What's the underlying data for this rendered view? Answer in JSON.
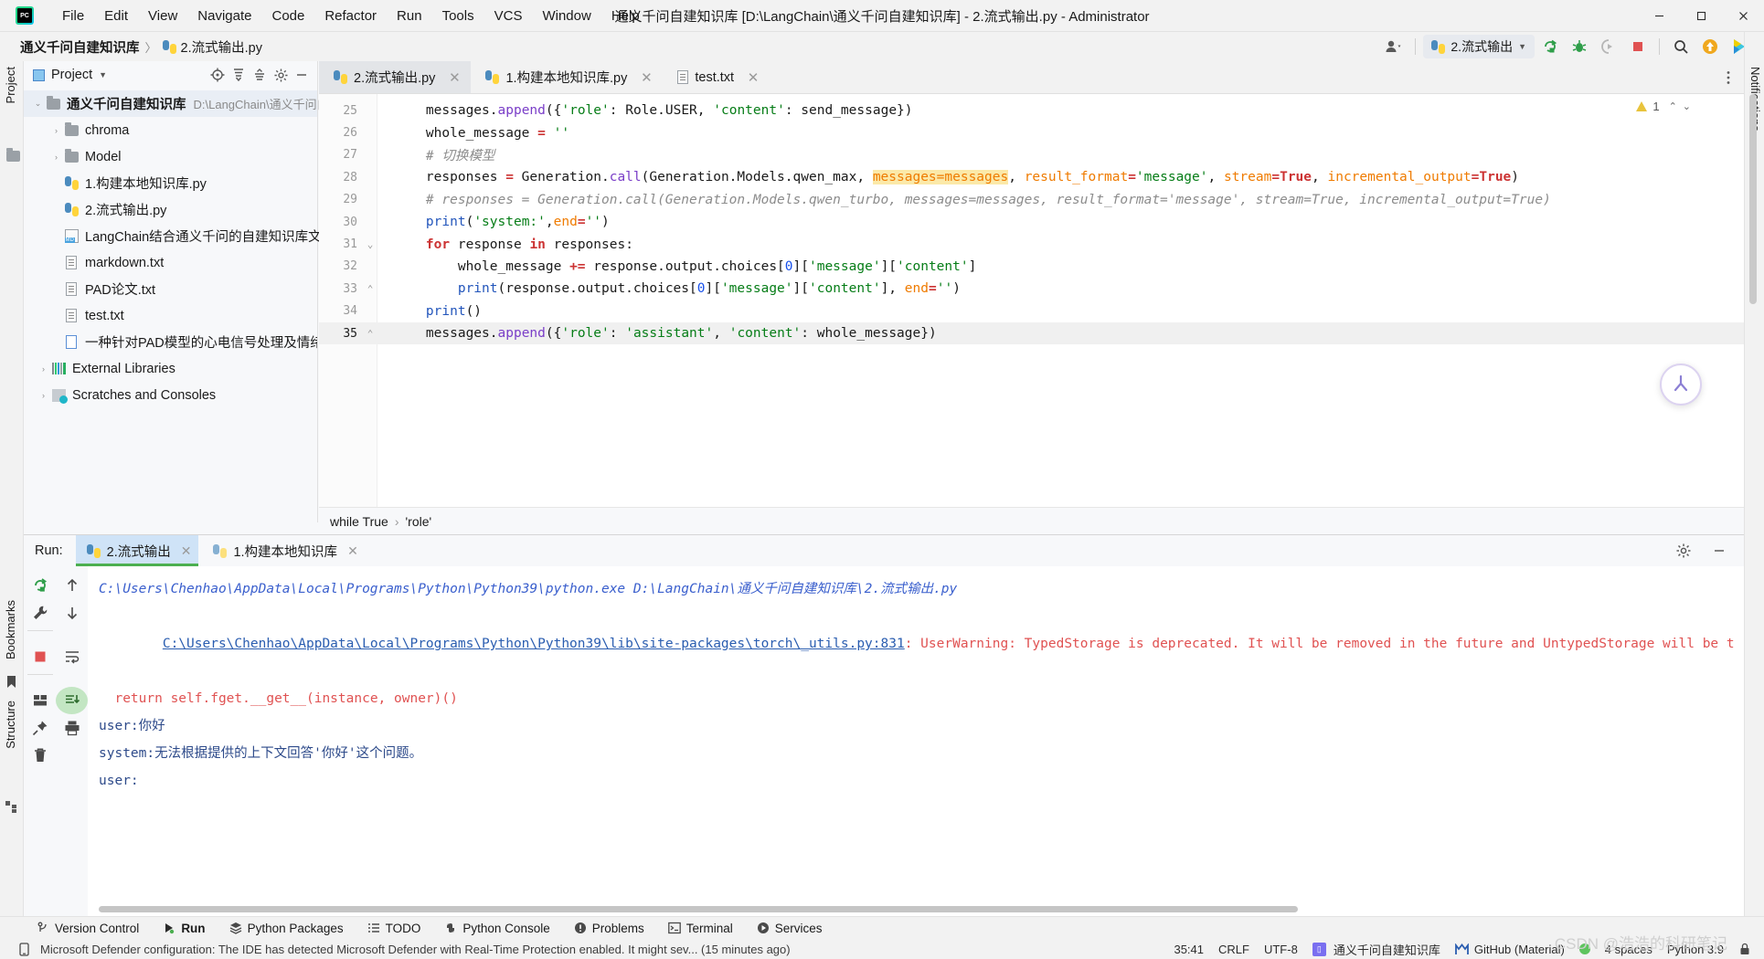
{
  "titlebar": {
    "app_logo": "pycharm-logo",
    "window_title": "通义千问自建知识库 [D:\\LangChain\\通义千问自建知识库] - 2.流式输出.py - Administrator",
    "menus": [
      "File",
      "Edit",
      "View",
      "Navigate",
      "Code",
      "Refactor",
      "Run",
      "Tools",
      "VCS",
      "Window",
      "Help"
    ],
    "controls": {
      "minimize": "—",
      "maximize": "▢",
      "close": "✕"
    }
  },
  "navbar": {
    "breadcrumb_project": "通义千问自建知识库",
    "breadcrumb_sep": "〉",
    "breadcrumb_file": "2.流式输出.py",
    "run_config": "2.流式输出",
    "icons": [
      "user-avatar-icon",
      "run-config-chevron",
      "rerun-icon",
      "debug-icon",
      "coverage-icon",
      "stop-icon",
      "search-everywhere-icon",
      "updates-icon",
      "ai-assistant-icon"
    ]
  },
  "left_stripe": {
    "project_label": "Project",
    "bookmarks_label": "Bookmarks",
    "structure_label": "Structure"
  },
  "right_stripe": {
    "notifications_label": "Notifications"
  },
  "project_panel": {
    "title": "Project",
    "header_icons": [
      "locate-icon",
      "expand-all-icon",
      "collapse-all-icon",
      "settings-icon",
      "hide-icon"
    ],
    "tree": [
      {
        "indent": 0,
        "arrow": "⌄",
        "icon": "folder-icon",
        "label": "通义千问自建知识库",
        "bold": true,
        "path": "D:\\LangChain\\通义千问自建知",
        "selected": true
      },
      {
        "indent": 1,
        "arrow": "›",
        "icon": "folder-icon",
        "label": "chroma",
        "bold": false,
        "path": "",
        "selected": false
      },
      {
        "indent": 1,
        "arrow": "›",
        "icon": "folder-icon",
        "label": "Model",
        "bold": false,
        "path": "",
        "selected": false
      },
      {
        "indent": 1,
        "arrow": "",
        "icon": "python-file-icon",
        "label": "1.构建本地知识库.py",
        "bold": false,
        "path": "",
        "selected": false
      },
      {
        "indent": 1,
        "arrow": "",
        "icon": "python-file-icon",
        "label": "2.流式输出.py",
        "bold": false,
        "path": "",
        "selected": false
      },
      {
        "indent": 1,
        "arrow": "",
        "icon": "markdown-file-icon",
        "label": "LangChain结合通义千问的自建知识库文档.md",
        "bold": false,
        "path": "",
        "selected": false
      },
      {
        "indent": 1,
        "arrow": "",
        "icon": "text-file-icon",
        "label": "markdown.txt",
        "bold": false,
        "path": "",
        "selected": false
      },
      {
        "indent": 1,
        "arrow": "",
        "icon": "text-file-icon",
        "label": "PAD论文.txt",
        "bold": false,
        "path": "",
        "selected": false
      },
      {
        "indent": 1,
        "arrow": "",
        "icon": "text-file-icon",
        "label": "test.txt",
        "bold": false,
        "path": "",
        "selected": false
      },
      {
        "indent": 1,
        "arrow": "",
        "icon": "pdf-file-icon",
        "label": "一种针对PAD模型的心电信号处理及情绪识别方",
        "bold": false,
        "path": "",
        "selected": false
      },
      {
        "indent": 0,
        "arrow": "›",
        "icon": "external-libraries-icon",
        "label": "External Libraries",
        "bold": false,
        "path": "",
        "selected": false
      },
      {
        "indent": 0,
        "arrow": "›",
        "icon": "scratches-icon",
        "label": "Scratches and Consoles",
        "bold": false,
        "path": "",
        "selected": false
      }
    ]
  },
  "editor": {
    "tabs": [
      {
        "label": "2.流式输出.py",
        "icon": "python-file-icon",
        "active": true
      },
      {
        "label": "1.构建本地知识库.py",
        "icon": "python-file-icon",
        "active": false
      },
      {
        "label": "test.txt",
        "icon": "text-file-icon",
        "active": false
      }
    ],
    "inspection_count": "1",
    "lines": [
      {
        "num": "25",
        "fold": "",
        "current": false,
        "tokens": [
          {
            "t": "    ",
            "c": "plain"
          },
          {
            "t": "messages",
            "c": "plain"
          },
          {
            "t": ".",
            "c": "plain"
          },
          {
            "t": "append",
            "c": "fn"
          },
          {
            "t": "({",
            "c": "plain"
          },
          {
            "t": "'role'",
            "c": "str"
          },
          {
            "t": ": Role.USER, ",
            "c": "plain"
          },
          {
            "t": "'content'",
            "c": "str"
          },
          {
            "t": ": send_message})",
            "c": "plain"
          }
        ]
      },
      {
        "num": "26",
        "fold": "",
        "current": false,
        "tokens": [
          {
            "t": "    whole_message ",
            "c": "plain"
          },
          {
            "t": "=",
            "c": "kw2"
          },
          {
            "t": " ",
            "c": "plain"
          },
          {
            "t": "''",
            "c": "str"
          }
        ]
      },
      {
        "num": "27",
        "fold": "",
        "current": false,
        "tokens": [
          {
            "t": "    # 切换模型",
            "c": "cmt"
          }
        ]
      },
      {
        "num": "28",
        "fold": "",
        "current": false,
        "tokens": [
          {
            "t": "    responses ",
            "c": "plain"
          },
          {
            "t": "=",
            "c": "kw2"
          },
          {
            "t": " Generation.",
            "c": "plain"
          },
          {
            "t": "call",
            "c": "fn"
          },
          {
            "t": "(Generation.Models.qwen_max, ",
            "c": "plain"
          },
          {
            "t": "messages=messages",
            "c": "param hl"
          },
          {
            "t": ", ",
            "c": "plain"
          },
          {
            "t": "result_format",
            "c": "param"
          },
          {
            "t": "=",
            "c": "kw2"
          },
          {
            "t": "'message'",
            "c": "str"
          },
          {
            "t": ", ",
            "c": "plain"
          },
          {
            "t": "stream",
            "c": "param"
          },
          {
            "t": "=",
            "c": "kw2"
          },
          {
            "t": "True",
            "c": "kw2"
          },
          {
            "t": ", ",
            "c": "plain"
          },
          {
            "t": "incremental_output",
            "c": "param"
          },
          {
            "t": "=",
            "c": "kw2"
          },
          {
            "t": "True",
            "c": "kw2"
          },
          {
            "t": ")",
            "c": "plain"
          }
        ]
      },
      {
        "num": "29",
        "fold": "",
        "current": false,
        "tokens": [
          {
            "t": "    # responses = Generation.call(Generation.Models.qwen_turbo, messages=messages, result_format='message', stream=True, incremental_output=True)",
            "c": "cmt"
          }
        ]
      },
      {
        "num": "30",
        "fold": "",
        "current": false,
        "tokens": [
          {
            "t": "    ",
            "c": "plain"
          },
          {
            "t": "print",
            "c": "bi"
          },
          {
            "t": "(",
            "c": "plain"
          },
          {
            "t": "'system:'",
            "c": "str"
          },
          {
            "t": ",",
            "c": "plain"
          },
          {
            "t": "end",
            "c": "param"
          },
          {
            "t": "=",
            "c": "kw2"
          },
          {
            "t": "''",
            "c": "str"
          },
          {
            "t": ")",
            "c": "plain"
          }
        ]
      },
      {
        "num": "31",
        "fold": "⌄",
        "current": false,
        "tokens": [
          {
            "t": "    ",
            "c": "plain"
          },
          {
            "t": "for",
            "c": "kw2"
          },
          {
            "t": " response ",
            "c": "plain"
          },
          {
            "t": "in",
            "c": "kw2"
          },
          {
            "t": " responses:",
            "c": "plain"
          }
        ]
      },
      {
        "num": "32",
        "fold": "",
        "current": false,
        "tokens": [
          {
            "t": "        whole_message ",
            "c": "plain"
          },
          {
            "t": "+=",
            "c": "kw2"
          },
          {
            "t": " response.output.choices[",
            "c": "plain"
          },
          {
            "t": "0",
            "c": "num"
          },
          {
            "t": "][",
            "c": "plain"
          },
          {
            "t": "'message'",
            "c": "str"
          },
          {
            "t": "][",
            "c": "plain"
          },
          {
            "t": "'content'",
            "c": "str"
          },
          {
            "t": "]",
            "c": "plain"
          }
        ]
      },
      {
        "num": "33",
        "fold": "⌃",
        "current": false,
        "tokens": [
          {
            "t": "        ",
            "c": "plain"
          },
          {
            "t": "print",
            "c": "bi"
          },
          {
            "t": "(response.output.choices[",
            "c": "plain"
          },
          {
            "t": "0",
            "c": "num"
          },
          {
            "t": "][",
            "c": "plain"
          },
          {
            "t": "'message'",
            "c": "str"
          },
          {
            "t": "][",
            "c": "plain"
          },
          {
            "t": "'content'",
            "c": "str"
          },
          {
            "t": "], ",
            "c": "plain"
          },
          {
            "t": "end",
            "c": "param"
          },
          {
            "t": "=",
            "c": "kw2"
          },
          {
            "t": "''",
            "c": "str"
          },
          {
            "t": ")",
            "c": "plain"
          }
        ]
      },
      {
        "num": "34",
        "fold": "",
        "current": false,
        "tokens": [
          {
            "t": "    ",
            "c": "plain"
          },
          {
            "t": "print",
            "c": "bi"
          },
          {
            "t": "()",
            "c": "plain"
          }
        ]
      },
      {
        "num": "35",
        "fold": "⌃",
        "current": true,
        "tokens": [
          {
            "t": "    ",
            "c": "plain"
          },
          {
            "t": "messages",
            "c": "plain"
          },
          {
            "t": ".",
            "c": "plain"
          },
          {
            "t": "append",
            "c": "fn"
          },
          {
            "t": "({",
            "c": "plain"
          },
          {
            "t": "'role'",
            "c": "str"
          },
          {
            "t": ": ",
            "c": "plain"
          },
          {
            "t": "'assistant'",
            "c": "str"
          },
          {
            "t": ", ",
            "c": "plain"
          },
          {
            "t": "'content'",
            "c": "str"
          },
          {
            "t": ": whole_message})",
            "c": "plain"
          }
        ]
      }
    ],
    "breadcrumbs": [
      "while True",
      "'role'"
    ],
    "breadcrumb_sep": "›"
  },
  "run_panel": {
    "label": "Run:",
    "tabs": [
      {
        "label": "2.流式输出",
        "icon": "python-file-icon",
        "active": true
      },
      {
        "label": "1.构建本地知识库",
        "icon": "python-file-icon",
        "active": false
      }
    ],
    "toolbar_icons": [
      "rerun-icon",
      "scroll-up-icon",
      "settings-wrench-icon",
      "scroll-down-icon",
      "stop-icon",
      "soft-wrap-icon",
      "layout-icon",
      "scroll-to-end-icon",
      "pin-icon",
      "print-icon",
      "trash-icon"
    ],
    "header_icons": [
      "settings-gear-icon",
      "hide-panel-icon"
    ],
    "console": [
      {
        "style": "c-path",
        "text": "C:\\Users\\Chenhao\\AppData\\Local\\Programs\\Python\\Python39\\python.exe D:\\LangChain\\通义千问自建知识库\\2.流式输出.py"
      },
      {
        "style": "c-link",
        "text": "C:\\Users\\Chenhao\\AppData\\Local\\Programs\\Python\\Python39\\lib\\site-packages\\torch\\_utils.py:831",
        "suffix_style": "c-err",
        "suffix": ": UserWarning: TypedStorage is deprecated. It will be removed in the future and UntypedStorage will be t"
      },
      {
        "style": "c-err",
        "text": "  return self.fget.__get__(instance, owner)()"
      },
      {
        "style": "c-out",
        "text": "user:你好"
      },
      {
        "style": "c-out",
        "text": "system:无法根据提供的上下文回答'你好'这个问题。"
      },
      {
        "style": "c-out",
        "text": "user:"
      }
    ]
  },
  "bottombar": {
    "items": [
      {
        "label": "Version Control",
        "icon": "branch-icon",
        "active": false
      },
      {
        "label": "Run",
        "icon": "run-icon",
        "active": true
      },
      {
        "label": "Python Packages",
        "icon": "packages-icon",
        "active": false
      },
      {
        "label": "TODO",
        "icon": "todo-icon",
        "active": false
      },
      {
        "label": "Python Console",
        "icon": "python-console-icon",
        "active": false
      },
      {
        "label": "Problems",
        "icon": "problems-icon",
        "active": false
      },
      {
        "label": "Terminal",
        "icon": "terminal-icon",
        "active": false
      },
      {
        "label": "Services",
        "icon": "services-icon",
        "active": false
      }
    ]
  },
  "statusbar": {
    "notification_icon": "notification-icon",
    "message": "Microsoft Defender configuration: The IDE has detected Microsoft Defender with Real-Time Protection enabled. It might sev... (15 minutes ago)",
    "caret_position": "35:41",
    "line_separator": "CRLF",
    "encoding": "UTF-8",
    "project_name": "通义千问自建知识库",
    "vcs_branch": "GitHub (Material)",
    "indent": "4 spaces",
    "interpreter": "Python 3.9",
    "watermark": "CSDN @浩浩的科研笔记"
  },
  "colors": {
    "accent_blue": "#4a86c8",
    "warning_yellow": "#e8c33c",
    "error_red": "#e05252",
    "success_green": "#5ec45e",
    "highlight_bg": "#fbe9a9",
    "tab_active_bg": "#e3e5e8",
    "run_tab_active_bg": "#cfe3f7"
  }
}
